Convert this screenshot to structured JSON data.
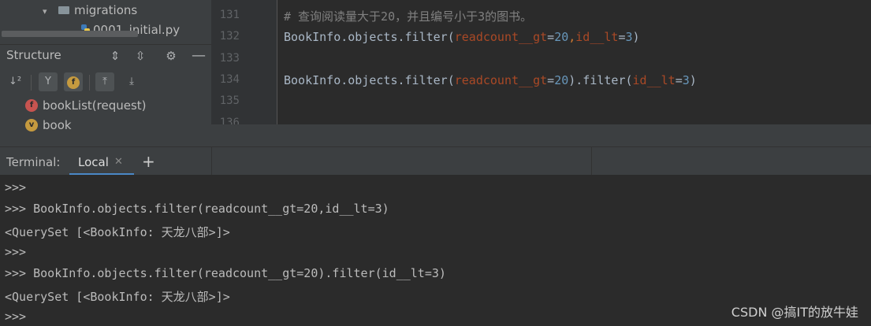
{
  "project_tree": {
    "folder": "migrations",
    "file": "0001_initial.py"
  },
  "structure": {
    "title": "Structure",
    "items": [
      {
        "badge": "f",
        "label": "bookList(request)"
      },
      {
        "badge": "v",
        "label": "book"
      }
    ]
  },
  "editor": {
    "line_numbers": [
      "131",
      "132",
      "133",
      "134",
      "135",
      "136"
    ],
    "comment": "# 查询阅读量大于20，并且编号小于3的图书。",
    "line132": {
      "obj": "BookInfo.objects.filter(",
      "p1": "readcount__gt",
      "eq1": "=",
      "v1": "20",
      "comma": ",",
      "p2": "id__lt",
      "eq2": "=",
      "v2": "3",
      "close": ")"
    },
    "line134": {
      "obj": "BookInfo.objects.filter(",
      "p1": "readcount__gt",
      "eq1": "=",
      "v1": "20",
      "mid": ").filter(",
      "p2": "id__lt",
      "eq2": "=",
      "v2": "3",
      "close": ")"
    }
  },
  "terminal": {
    "title": "Terminal:",
    "tab": "Local",
    "add_label": "+",
    "lines": [
      ">>>",
      ">>> BookInfo.objects.filter(readcount__gt=20,id__lt=3)",
      "<QuerySet [<BookInfo: 天龙八部>]>",
      ">>>",
      ">>> BookInfo.objects.filter(readcount__gt=20).filter(id__lt=3)",
      "<QuerySet [<BookInfo: 天龙八部>]>",
      ">>>"
    ]
  },
  "watermark": "CSDN @搞IT的放牛娃",
  "colors": {
    "accent": "#4a88c7",
    "param": "#aa4926",
    "number": "#6897bb",
    "comment": "#808080"
  }
}
